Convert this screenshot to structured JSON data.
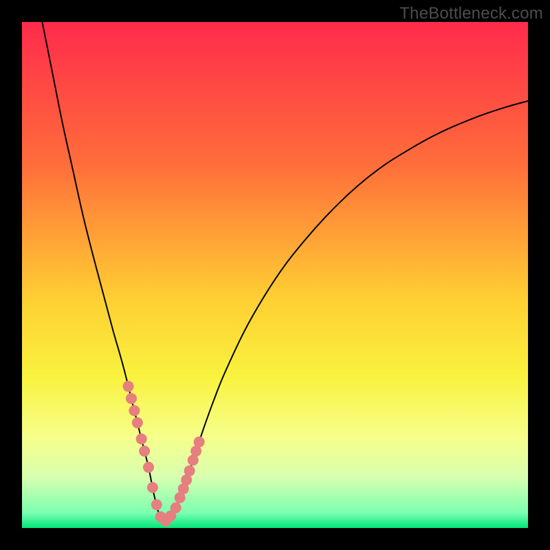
{
  "watermark": "TheBottleneck.com",
  "colors": {
    "frame": "#000000",
    "gradient_stops": [
      {
        "offset": 0.0,
        "color": "#ff2b4c"
      },
      {
        "offset": 0.28,
        "color": "#ff6d3a"
      },
      {
        "offset": 0.55,
        "color": "#ffd033"
      },
      {
        "offset": 0.7,
        "color": "#f9f23e"
      },
      {
        "offset": 0.82,
        "color": "#f6ff8a"
      },
      {
        "offset": 0.9,
        "color": "#d8ffb0"
      },
      {
        "offset": 0.97,
        "color": "#7cffb0"
      },
      {
        "offset": 1.0,
        "color": "#00e67a"
      }
    ],
    "curve": "#000000",
    "marker": "#e67f7f"
  },
  "chart_data": {
    "type": "line",
    "title": "",
    "xlabel": "",
    "ylabel": "",
    "xlim": [
      0,
      100
    ],
    "ylim": [
      0,
      100
    ],
    "grid": false,
    "x": [
      4,
      6,
      8,
      10,
      12,
      14,
      16,
      18,
      20,
      22,
      23.5,
      25,
      26,
      27,
      28,
      30,
      32,
      34,
      36,
      38,
      40,
      44,
      48,
      52,
      56,
      60,
      64,
      68,
      72,
      76,
      80,
      84,
      88,
      92,
      96,
      100
    ],
    "values": [
      100,
      90,
      80,
      71,
      62,
      54,
      46.5,
      39,
      32,
      24,
      18,
      12,
      7,
      3,
      1,
      3,
      8,
      14,
      20,
      25.5,
      30.5,
      39,
      46,
      52,
      57,
      61.5,
      65.5,
      69,
      72,
      74.5,
      76.8,
      78.8,
      80.5,
      82,
      83.3,
      84.4
    ],
    "marker_points_x": [
      21.0,
      21.6,
      22.2,
      22.8,
      23.6,
      24.2,
      25.0,
      25.8,
      26.6,
      27.4,
      28.4,
      29.4,
      30.4,
      31.2,
      31.9,
      32.5,
      33.1,
      33.8,
      34.4,
      35.0
    ]
  }
}
